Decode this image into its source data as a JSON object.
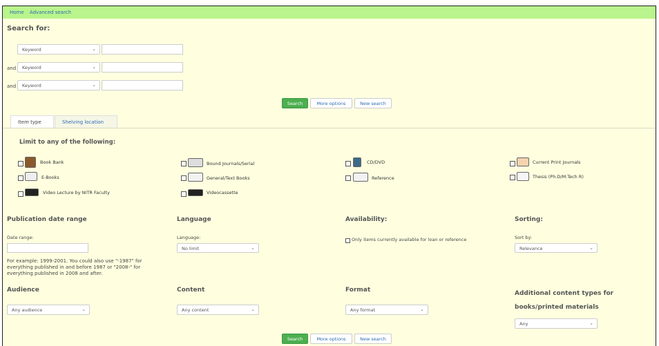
{
  "breadcrumb": {
    "home": "Home",
    "advanced": "Advanced search"
  },
  "search": {
    "heading": "Search for:",
    "rows": [
      {
        "bool": "",
        "field": "Keyword"
      },
      {
        "bool": "and",
        "field": "Keyword"
      },
      {
        "bool": "and",
        "field": "Keyword"
      }
    ]
  },
  "buttons": {
    "search": "Search",
    "more": "More options",
    "new": "New search"
  },
  "tabs": {
    "item_type": "Item type",
    "shelving": "Shelving location"
  },
  "limit": {
    "heading": "Limit to any of the following:",
    "items": [
      {
        "label": "Book Bank",
        "icon": "book-bank-icon"
      },
      {
        "label": "Bound Journals/Serial",
        "icon": "bound-journals-icon"
      },
      {
        "label": "CD/DVD",
        "icon": "cd-dvd-icon"
      },
      {
        "label": "Current Print Journals",
        "icon": "current-journals-icon"
      },
      {
        "label": "E-Books",
        "icon": "ebooks-icon"
      },
      {
        "label": "General/Text Books",
        "icon": "text-books-icon"
      },
      {
        "label": "Reference",
        "icon": "reference-icon"
      },
      {
        "label": "Thesis (Ph.D/M.Tech R)",
        "icon": "thesis-icon"
      },
      {
        "label": "Video Lecture by NITR Faculty",
        "icon": "video-lecture-icon"
      },
      {
        "label": "Videocassette",
        "icon": "videocassette-icon"
      }
    ]
  },
  "pubdate": {
    "heading": "Publication date range",
    "label": "Date range:",
    "note": "For example: 1999-2001. You could also use \"-1987\" for everything published in and before 1987 or \"2008-\" for everything published in 2008 and after."
  },
  "language": {
    "heading": "Language",
    "label": "Language:",
    "value": "No limit"
  },
  "availability": {
    "heading": "Availability:",
    "label": "Only items currently available for loan or reference"
  },
  "sorting": {
    "heading": "Sorting:",
    "label": "Sort by:",
    "value": "Relevance"
  },
  "audience": {
    "heading": "Audience",
    "value": "Any audience"
  },
  "content": {
    "heading": "Content",
    "value": "Any content"
  },
  "format": {
    "heading": "Format",
    "value": "Any format"
  },
  "additional": {
    "heading": "Additional content types for books/printed materials",
    "value": "Any"
  },
  "colors": {
    "breadcrumb_bg": "#b9f48c",
    "page_bg": "#ffffe0",
    "search_btn": "#4caf50",
    "link": "#2a6db5"
  }
}
